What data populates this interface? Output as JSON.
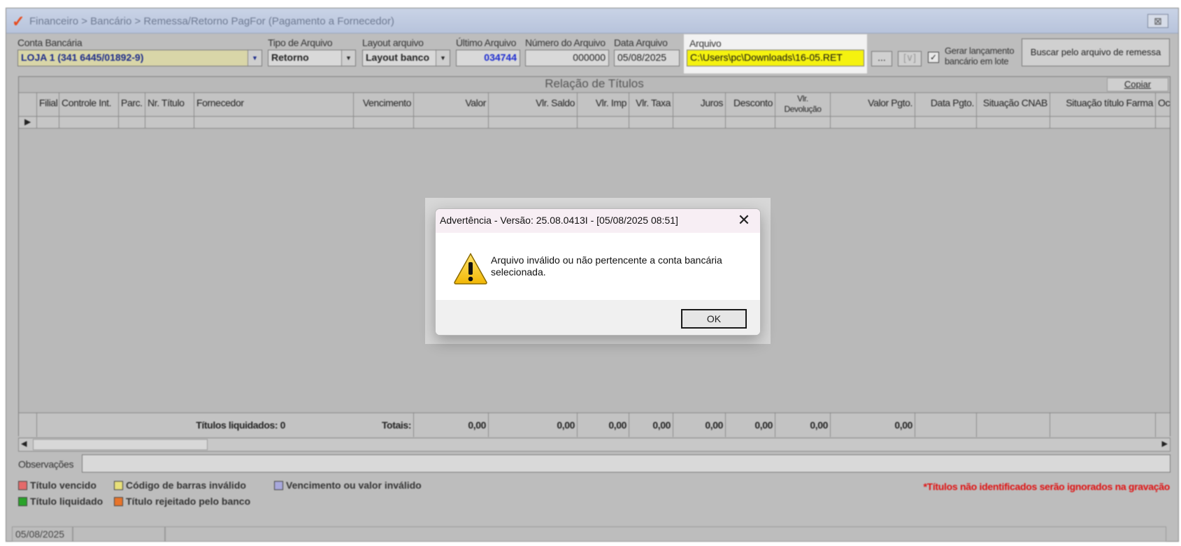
{
  "window": {
    "title": "Financeiro > Bancário > Remessa/Retorno PagFor (Pagamento  a Fornecedor)",
    "close_symbol": "⊠"
  },
  "filters": {
    "conta_label": "Conta Bancária",
    "conta_value": "LOJA 1 (341 6445/01892-9)",
    "tipo_label": "Tipo de Arquivo",
    "tipo_value": "Retorno",
    "layout_label": "Layout arquivo",
    "layout_value": "Layout banco",
    "ultimo_label": "Último Arquivo",
    "ultimo_value": "034744",
    "numero_label": "Número do Arquivo",
    "numero_value": "000000",
    "data_label": "Data Arquivo",
    "data_value": "05/08/2025",
    "arquivo_label": "Arquivo",
    "arquivo_value": "C:\\Users\\pc\\Downloads\\16-05.RET",
    "browse_label": "...",
    "view_label": "[∨]",
    "gerar_label_1": "Gerar lançamento",
    "gerar_label_2": "bancário em lote",
    "gerar_checked": true,
    "buscar_label": "Buscar pelo arquivo de remessa"
  },
  "grid": {
    "title": "Relação de Títulos",
    "copy_label": "Copiar",
    "columns": [
      "Filial",
      "Controle Int.",
      "Parc.",
      "Nr. Título",
      "Fornecedor",
      "Vencimento",
      "Valor",
      "Vlr. Saldo",
      "Vlr. Imp",
      "Vlr. Taxa",
      "Juros",
      "Desconto",
      "Vlr. Devolução",
      "Valor Pgto.",
      "Data Pgto.",
      "Situação CNAB",
      "Situação título Farma",
      "Oc"
    ],
    "footer": {
      "titulos_liquidados": "Títulos liquidados: 0",
      "totais_label": "Totais:",
      "valor": "0,00",
      "saldo": "0,00",
      "imp": "0,00",
      "taxa": "0,00",
      "juros": "0,00",
      "desconto": "0,00",
      "devolucao": "0,00",
      "pgto": "0,00"
    }
  },
  "observacoes_label": "Observações",
  "legend": {
    "vencido": "Título vencido",
    "codigo_invalido": "Código de barras inválido",
    "vencimento_invalido": "Vencimento ou valor inválido",
    "liquidado": "Título liquidado",
    "rejeitado": "Título rejeitado pelo banco",
    "aviso": "*Títulos não identificados serão ignorados na gravação",
    "colors": {
      "vencido": "#e46a6a",
      "codigo_invalido": "#e8e07a",
      "vencimento_invalido": "#a8a8dc",
      "liquidado": "#2aa32a",
      "rejeitado": "#e8742a",
      "aviso": "#e01010"
    }
  },
  "status": {
    "date": "05/08/2025"
  },
  "dialog": {
    "title": "Advertência - Versão: 25.08.0413I - [05/08/2025 08:51]",
    "message": "Arquivo inválido ou não pertencente a conta bancária selecionada.",
    "ok_label": "OK",
    "close_symbol": "✕",
    "icon": "warning-icon"
  }
}
